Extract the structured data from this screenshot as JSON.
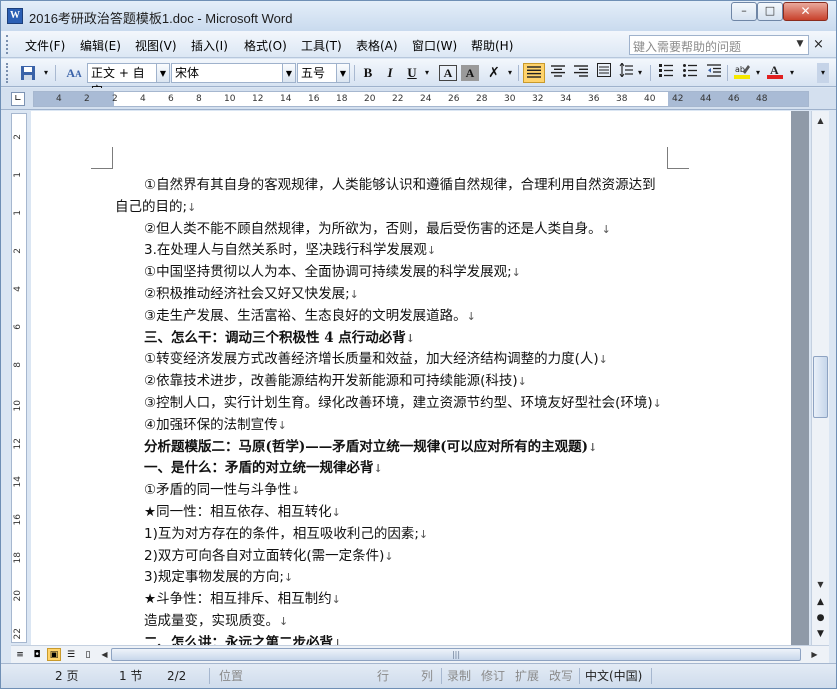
{
  "window": {
    "title": "2016考研政治答题模板1.doc - Microsoft Word",
    "app_icon_letter": "W",
    "controls": {
      "minimize": "–",
      "maximize": "□",
      "close": "✕"
    }
  },
  "menubar": {
    "items": [
      "文件(F)",
      "编辑(E)",
      "视图(V)",
      "插入(I)",
      "格式(O)",
      "工具(T)",
      "表格(A)",
      "窗口(W)",
      "帮助(H)"
    ],
    "help_placeholder": "键入需要帮助的问题",
    "close_doc": "×"
  },
  "toolbar": {
    "style_value": "正文 + 自定",
    "font_value": "宋体",
    "size_value": "五号",
    "bold": "B",
    "italic": "I",
    "underline": "U",
    "char_border": "A",
    "char_shading": "A",
    "highlight_color": "#f5e800",
    "font_color": "#e02020"
  },
  "ruler": {
    "h_ticks": [
      "4",
      "2",
      "2",
      "4",
      "6",
      "8",
      "10",
      "12",
      "14",
      "16",
      "18",
      "20",
      "22",
      "24",
      "26",
      "28",
      "30",
      "32",
      "34",
      "36",
      "38",
      "40",
      "42",
      "44",
      "46",
      "48"
    ],
    "v_ticks": [
      "2",
      "1",
      "1",
      "2",
      "4",
      "6",
      "8",
      "10",
      "12",
      "14",
      "16",
      "18",
      "20",
      "22"
    ]
  },
  "document": {
    "paragraphs": [
      {
        "text": "①自然界有其自身的客观规律，人类能够认识和遵循自然规律，合理利用自然资源达到",
        "mark": "",
        "bold": false,
        "cont": false
      },
      {
        "text": "自己的目的;",
        "mark": "↓",
        "bold": false,
        "cont": true
      },
      {
        "text": "②但人类不能不顾自然规律，为所欲为，否则，最后受伤害的还是人类自身。",
        "mark": "↓",
        "bold": false,
        "cont": false
      },
      {
        "text": "3.在处理人与自然关系时，坚决践行科学发展观",
        "mark": "↓",
        "bold": false,
        "cont": false
      },
      {
        "text": "①中国坚持贯彻以人为本、全面协调可持续发展的科学发展观;",
        "mark": "↓",
        "bold": false,
        "cont": false
      },
      {
        "text": "②积极推动经济社会又好又快发展;",
        "mark": "↓",
        "bold": false,
        "cont": false
      },
      {
        "text": "③走生产发展、生活富裕、生态良好的文明发展道路。",
        "mark": "↓",
        "bold": false,
        "cont": false
      },
      {
        "text": "三、怎么干：调动三个积极性 4 点行动必背",
        "mark": "↓",
        "bold": true,
        "cont": false
      },
      {
        "text": "①转变经济发展方式改善经济增长质量和效益，加大经济结构调整的力度(人)",
        "mark": "↓",
        "bold": false,
        "cont": false
      },
      {
        "text": "②依靠技术进步，改善能源结构开发新能源和可持续能源(科技)",
        "mark": "↓",
        "bold": false,
        "cont": false
      },
      {
        "text": "③控制人口，实行计划生育。绿化改善环境，建立资源节约型、环境友好型社会(环境)",
        "mark": "↓",
        "bold": false,
        "cont": false
      },
      {
        "text": "④加强环保的法制宣传",
        "mark": "↓",
        "bold": false,
        "cont": false
      },
      {
        "text": "分析题模版二：马原(哲学)——矛盾对立统一规律(可以应对所有的主观题)",
        "mark": "↓",
        "bold": true,
        "cont": false
      },
      {
        "text": "一、是什么：矛盾的对立统一规律必背",
        "mark": "↓",
        "bold": true,
        "cont": false
      },
      {
        "text": "①矛盾的同一性与斗争性",
        "mark": "↓",
        "bold": false,
        "cont": false
      },
      {
        "text": "★同一性：相互依存、相互转化",
        "mark": "↓",
        "bold": false,
        "cont": false
      },
      {
        "text": "1)互为对方存在的条件，相互吸收利己的因素;",
        "mark": "↓",
        "bold": false,
        "cont": false
      },
      {
        "text": "2)双方可向各自对立面转化(需一定条件)",
        "mark": "↓",
        "bold": false,
        "cont": false
      },
      {
        "text": "3)规定事物发展的方向;",
        "mark": "↓",
        "bold": false,
        "cont": false
      },
      {
        "text": "★斗争性：相互排斥、相互制约",
        "mark": "↓",
        "bold": false,
        "cont": false
      },
      {
        "text": "造成量变，实现质变。",
        "mark": "↓",
        "bold": false,
        "cont": false
      },
      {
        "text": "二、怎么讲：永远之第二步必背",
        "mark": "↓",
        "bold": true,
        "cont": false
      }
    ]
  },
  "statusbar": {
    "page": "2 页",
    "section": "1 节",
    "page_of": "2/2",
    "position": "位置",
    "line": "行",
    "column": "列",
    "record": "录制",
    "revise": "修订",
    "extend": "扩展",
    "overtype": "改写",
    "language": "中文(中国)"
  }
}
